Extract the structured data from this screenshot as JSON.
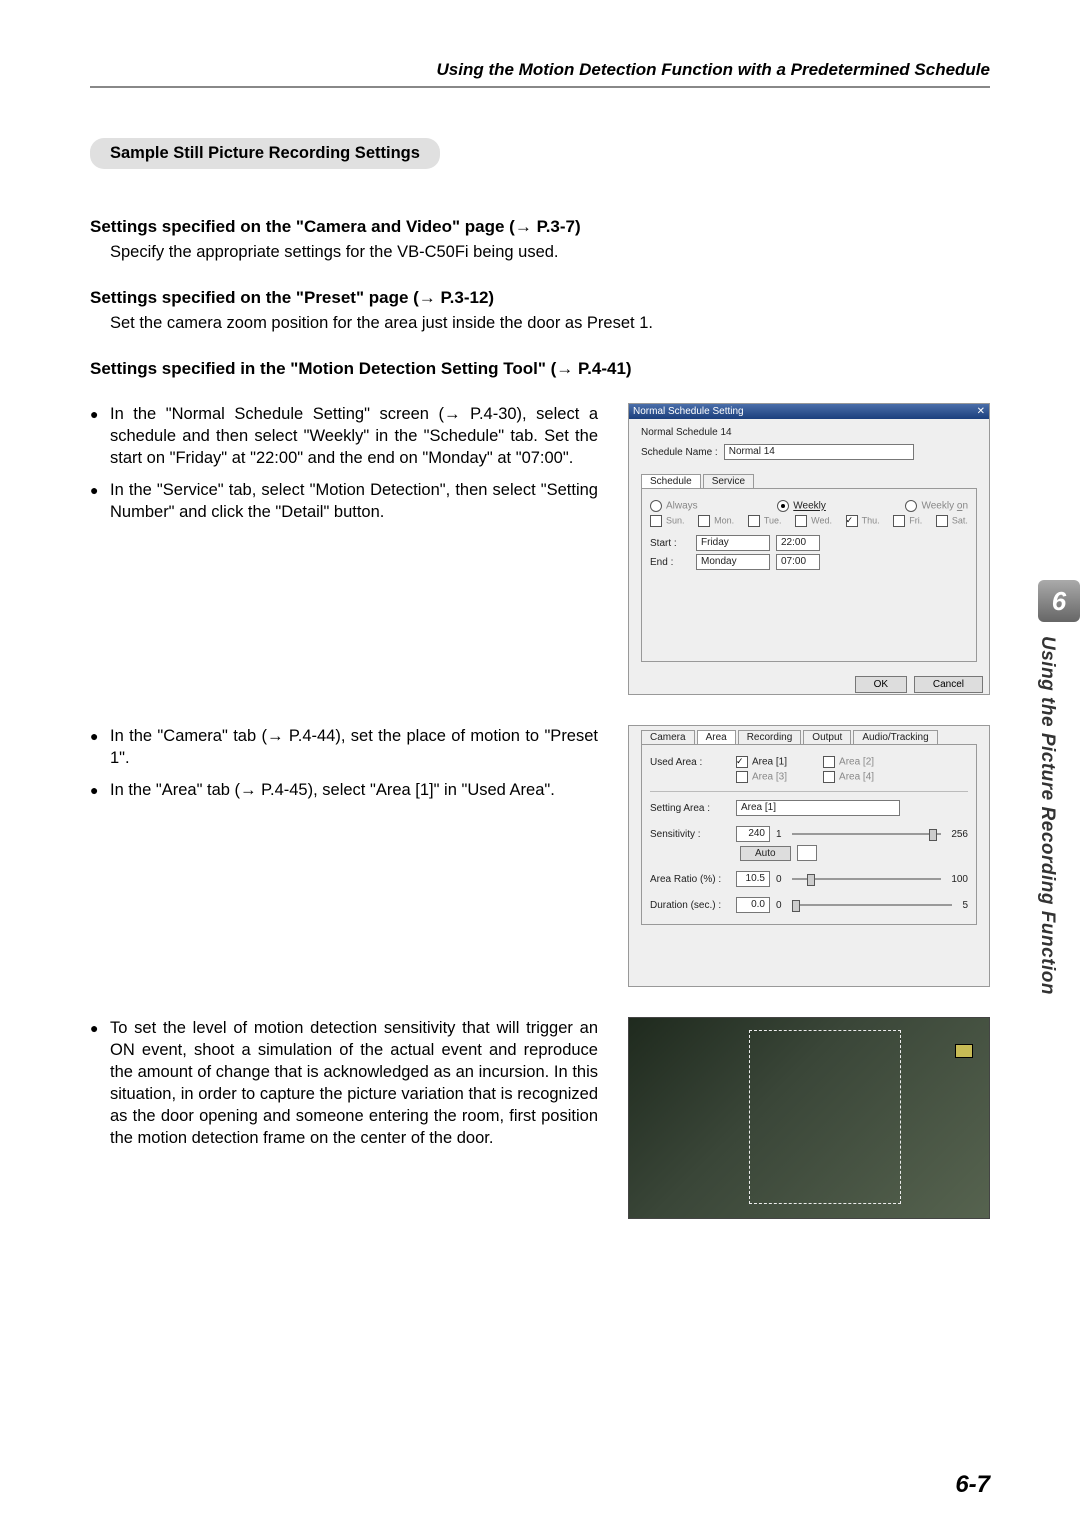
{
  "header": "Using the Motion Detection Function with a Predetermined Schedule",
  "pill": "Sample Still Picture Recording Settings",
  "sec1_head": "Settings specified on the \"Camera and Video\" page (→ P.3-7)",
  "sec1_body": "Specify the appropriate settings for the VB-C50Fi being used.",
  "sec2_head": "Settings specified on the \"Preset\" page (→ P.3-12)",
  "sec2_body": "Set the camera zoom position for the area just inside the door as Preset 1.",
  "sec3_head": "Settings specified in the \"Motion Detection Setting Tool\" (→ P.4-41)",
  "b1": "In the \"Normal Schedule Setting\" screen (→ P.4-30), select a schedule and then select \"Weekly\" in the \"Schedule\" tab. Set the start on \"Friday\" at \"22:00\" and the end on \"Monday\" at \"07:00\".",
  "b2": "In the \"Service\" tab, select \"Motion Detection\", then select \"Setting Number\" and click the \"Detail\" button.",
  "b3": "In the \"Camera\" tab (→ P.4-44), set the place of motion to \"Preset 1\".",
  "b4": "In the \"Area\" tab (→ P.4-45), select \"Area [1]\" in \"Used Area\".",
  "b5": "To set the level of motion detection sensitivity that will trigger an ON event, shoot a simulation of the actual event and reproduce the amount of change that is acknowledged as an incursion. In this situation, in order to capture the picture variation that is recognized as the door opening and someone entering the room, first position the motion detection frame on the center of the door.",
  "dlg1": {
    "title": "Normal Schedule Setting",
    "subtitle": "Normal Schedule 14",
    "name_label": "Schedule Name :",
    "name_value": "Normal 14",
    "tab_schedule": "Schedule",
    "tab_service": "Service",
    "r_always": "Always",
    "r_weekly": "Weekly",
    "r_weeklyon": "Weekly on",
    "days": [
      "Sun.",
      "Mon.",
      "Tue.",
      "Wed.",
      "Thu.",
      "Fri.",
      "Sat."
    ],
    "start_label": "Start :",
    "start_day": "Friday",
    "start_time": "22:00",
    "end_label": "End :",
    "end_day": "Monday",
    "end_time": "07:00",
    "ok": "OK",
    "cancel": "Cancel"
  },
  "dlg2": {
    "tabs": [
      "Camera",
      "Area",
      "Recording",
      "Output",
      "Audio/Tracking"
    ],
    "used_area": "Used Area :",
    "areas": [
      "Area [1]",
      "Area [2]",
      "Area [3]",
      "Area [4]"
    ],
    "setting_area": "Setting Area :",
    "setting_value": "Area [1]",
    "sensitivity": "Sensitivity :",
    "sens_val": "240",
    "sens_min": "1",
    "sens_max": "256",
    "auto": "Auto",
    "area_ratio": "Area Ratio (%) :",
    "area_val": "10.5",
    "ar_min": "0",
    "ar_max": "100",
    "duration": "Duration (sec.) :",
    "dur_val": "0.0",
    "dur_min": "0",
    "dur_max": "5"
  },
  "sidebar_num": "6",
  "sidebar_text": "Using the Picture Recording Function",
  "page_num": "6-7"
}
